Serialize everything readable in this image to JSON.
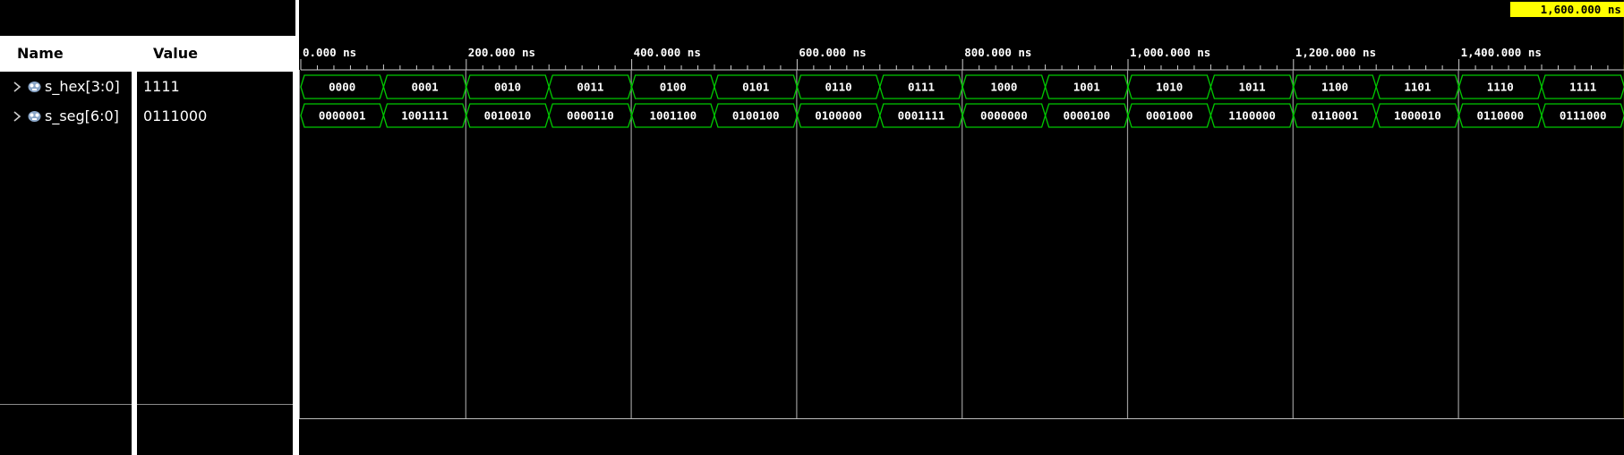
{
  "headers": {
    "name": "Name",
    "value": "Value"
  },
  "signals": [
    {
      "name": "s_hex[3:0]",
      "value": "1111",
      "transitions": [
        "0000",
        "0001",
        "0010",
        "0011",
        "0100",
        "0101",
        "0110",
        "0111",
        "1000",
        "1001",
        "1010",
        "1011",
        "1100",
        "1101",
        "1110",
        "1111"
      ]
    },
    {
      "name": "s_seg[6:0]",
      "value": "0111000",
      "transitions": [
        "0000001",
        "1001111",
        "0010010",
        "0000110",
        "1001100",
        "0100100",
        "0100000",
        "0001111",
        "0000000",
        "0000100",
        "0001000",
        "1100000",
        "0110001",
        "1000010",
        "0110000",
        "0111000"
      ]
    }
  ],
  "timeline": {
    "unit": "ns",
    "step_ns": 100,
    "major_labels": [
      "0.000 ns",
      "200.000 ns",
      "400.000 ns",
      "600.000 ns",
      "800.000 ns",
      "1,000.000 ns",
      "1,200.000 ns",
      "1,400.000 ns"
    ],
    "cursor_label": "1,600.000 ns",
    "cursor_time_ns": 1600
  },
  "colors": {
    "waveform": "#00c800",
    "cursor": "#ffff00",
    "grid": "#9a9a9a",
    "background": "#000000"
  },
  "icons": {
    "expand": "chevron-right-icon",
    "signal": "bus-signal-icon"
  }
}
